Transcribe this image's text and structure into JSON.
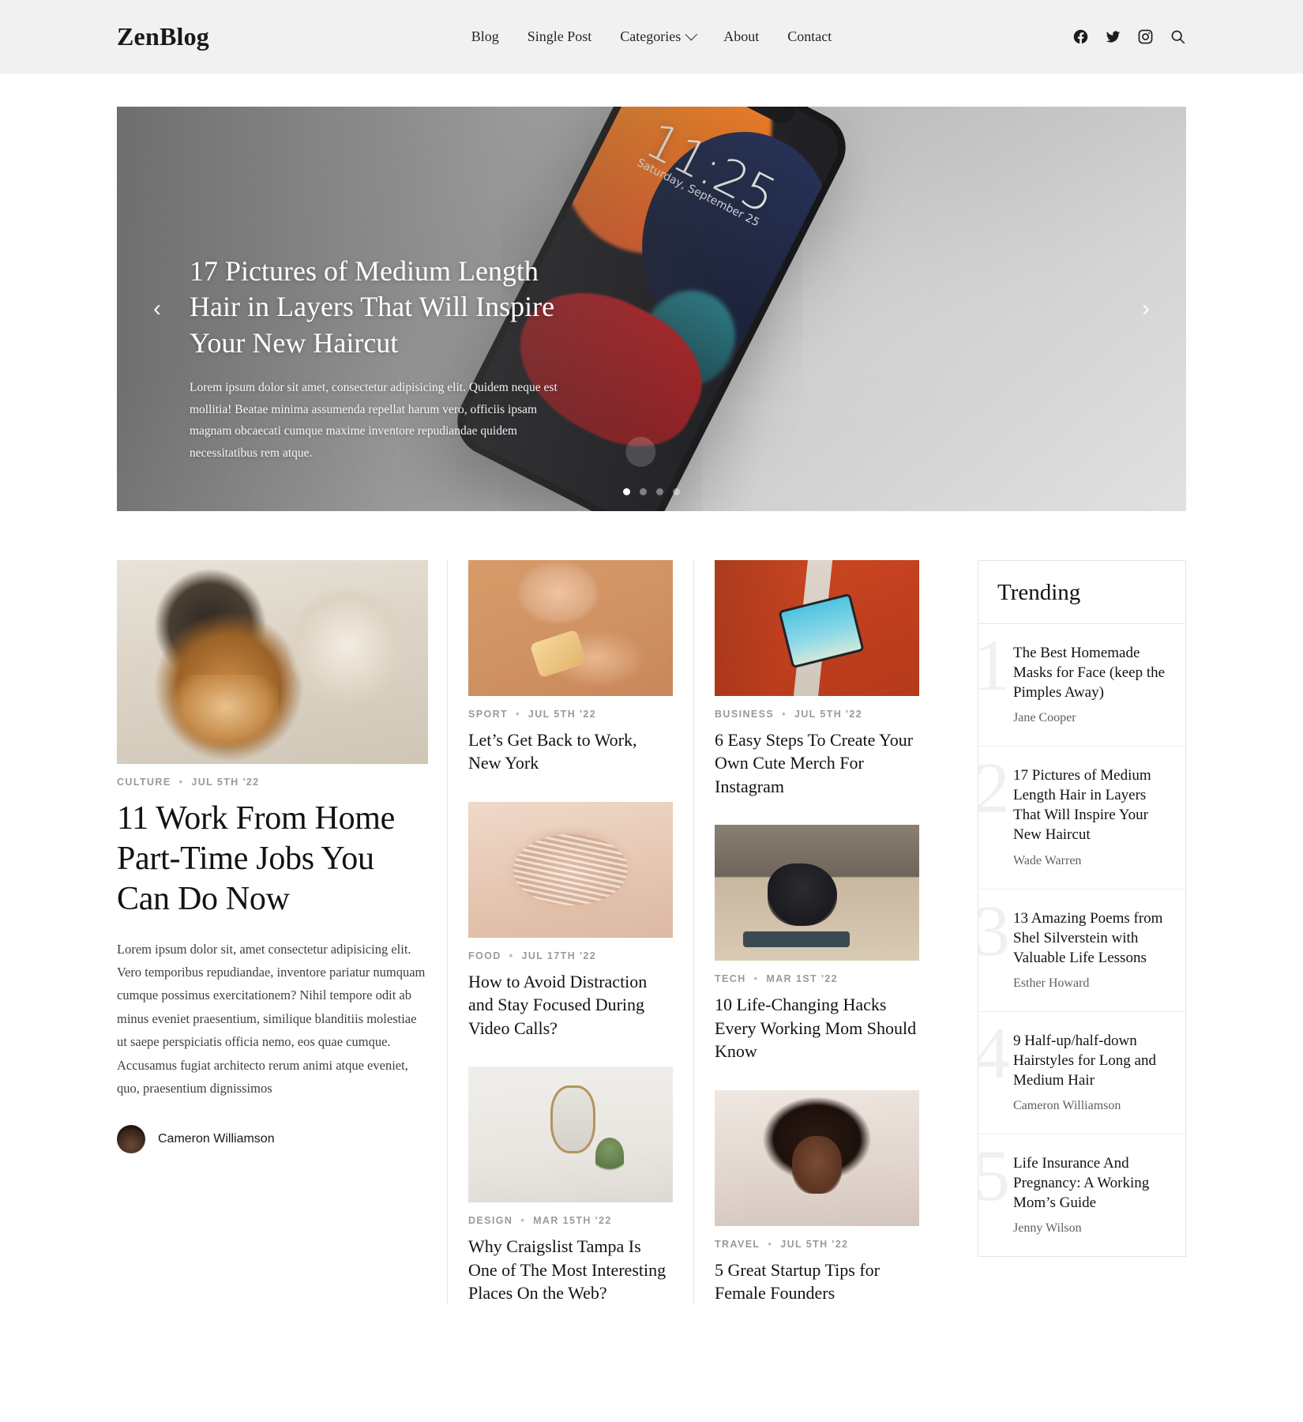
{
  "header": {
    "brand": "ZenBlog",
    "nav": [
      {
        "label": "Blog",
        "has_dropdown": false
      },
      {
        "label": "Single Post",
        "has_dropdown": false
      },
      {
        "label": "Categories",
        "has_dropdown": true
      },
      {
        "label": "About",
        "has_dropdown": false
      },
      {
        "label": "Contact",
        "has_dropdown": false
      }
    ],
    "icons": [
      "facebook-icon",
      "twitter-icon",
      "instagram-icon",
      "search-icon"
    ]
  },
  "hero": {
    "title": "17 Pictures of Medium Length Hair in Layers That Will Inspire Your New Haircut",
    "description": "Lorem ipsum dolor sit amet, consectetur adipisicing elit. Quidem neque est mollitia! Beatae minima assumenda repellat harum vero, officiis ipsam magnam obcaecati cumque maxime inventore repudiandae quidem necessitatibus rem atque.",
    "prev_label": "‹",
    "next_label": "›",
    "slide_count": 4,
    "active_slide": 1,
    "image_alt": "iphone-lock-screen-photo",
    "phone_time": "11:25",
    "phone_date": "Saturday, September 25"
  },
  "feature": {
    "category": "CULTURE",
    "separator": "•",
    "date": "JUL 5TH '22",
    "title": "11 Work From Home Part-Time Jobs You Can Do Now",
    "excerpt": "Lorem ipsum dolor sit, amet consectetur adipisicing elit. Vero temporibus repudiandae, inventore pariatur numquam cumque possimus exercitationem? Nihil tempore odit ab minus eveniet praesentium, similique blanditiis molestiae ut saepe perspiciatis officia nemo, eos quae cumque. Accusamus fugiat architecto rerum animi atque eveniet, quo, praesentium dignissimos",
    "author": "Cameron Williamson",
    "image_alt": "beagle-puppy-photo"
  },
  "column_mid": [
    {
      "category": "SPORT",
      "separator": "•",
      "date": "JUL 5TH '22",
      "title": "Let’s Get Back to Work, New York",
      "image_alt": "hands-passing-pastry-photo"
    },
    {
      "category": "FOOD",
      "separator": "•",
      "date": "JUL 17TH '22",
      "title": "How to Avoid Distraction and Stay Focused During Video Calls?",
      "image_alt": "folded-paper-photo"
    },
    {
      "category": "DESIGN",
      "separator": "•",
      "date": "MAR 15TH '22",
      "title": "Why Craigslist Tampa Is One of The Most Interesting Places On the Web?",
      "image_alt": "mirror-and-plant-photo"
    }
  ],
  "column_right": [
    {
      "category": "BUSINESS",
      "separator": "•",
      "date": "JUL 5TH '22",
      "title": "6 Easy Steps To Create Your Own Cute Merch For Instagram",
      "image_alt": "tablet-on-orange-track-photo"
    },
    {
      "category": "TECH",
      "separator": "•",
      "date": "MAR 1ST '22",
      "title": "10 Life-Changing Hacks Every Working Mom Should Know",
      "image_alt": "yoga-with-child-photo"
    },
    {
      "category": "TRAVEL",
      "separator": "•",
      "date": "JUL 5TH '22",
      "title": "5 Great Startup Tips for Female Founders",
      "image_alt": "portrait-woman-photo"
    }
  ],
  "trending": {
    "heading": "Trending",
    "items": [
      {
        "rank": "1",
        "title": "The Best Homemade Masks for Face (keep the Pimples Away)",
        "author": "Jane Cooper"
      },
      {
        "rank": "2",
        "title": "17 Pictures of Medium Length Hair in Layers That Will Inspire Your New Haircut",
        "author": "Wade Warren"
      },
      {
        "rank": "3",
        "title": "13 Amazing Poems from Shel Silverstein with Valuable Life Lessons",
        "author": "Esther Howard"
      },
      {
        "rank": "4",
        "title": "9 Half-up/half-down Hairstyles for Long and Medium Hair",
        "author": "Cameron Williamson"
      },
      {
        "rank": "5",
        "title": "Life Insurance And Pregnancy: A Working Mom’s Guide",
        "author": "Jenny Wilson"
      }
    ]
  },
  "colors": {
    "header_bg": "#f1f1f1",
    "text_primary": "#111214",
    "meta_gray": "#9a9a9a",
    "border": "#e6e6e6",
    "rank_watermark": "#f0f0f0"
  }
}
